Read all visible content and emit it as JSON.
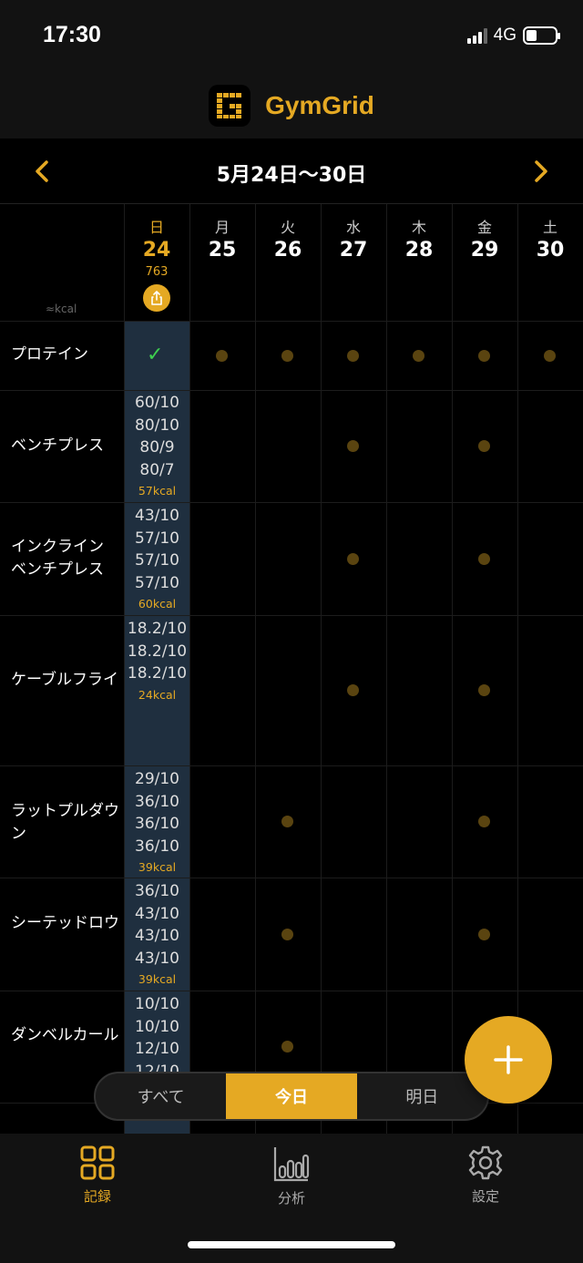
{
  "status": {
    "time": "17:30",
    "network": "4G"
  },
  "app": {
    "title": "GymGrid"
  },
  "week": {
    "range": "5月24日〜30日"
  },
  "kcal_unit": "≈kcal",
  "days": [
    {
      "dow": "日",
      "num": "24",
      "kcal": "763",
      "today": true
    },
    {
      "dow": "月",
      "num": "25"
    },
    {
      "dow": "火",
      "num": "26"
    },
    {
      "dow": "水",
      "num": "27"
    },
    {
      "dow": "木",
      "num": "28"
    },
    {
      "dow": "金",
      "num": "29"
    },
    {
      "dow": "土",
      "num": "30"
    }
  ],
  "exercises": [
    {
      "name": "プロテイン",
      "today_check": "✓"
    },
    {
      "name": "ベンチプレス",
      "sets": [
        "60/10",
        "80/10",
        "80/9",
        "80/7"
      ],
      "kcal": "57kcal"
    },
    {
      "name": "インクライン ベンチプレス",
      "sets": [
        "43/10",
        "57/10",
        "57/10",
        "57/10"
      ],
      "kcal": "60kcal"
    },
    {
      "name": "ケーブルフライ",
      "sets": [
        "18.2/10",
        "18.2/10",
        "18.2/10"
      ],
      "kcal": "24kcal"
    },
    {
      "name": "ラットプルダウン",
      "sets": [
        "29/10",
        "36/10",
        "36/10",
        "36/10"
      ],
      "kcal": "39kcal"
    },
    {
      "name": "シーテッドロウ",
      "sets": [
        "36/10",
        "43/10",
        "43/10",
        "43/10"
      ],
      "kcal": "39kcal"
    },
    {
      "name": "ダンベルカール",
      "sets": [
        "10/10",
        "10/10",
        "12/10",
        "12/10"
      ]
    }
  ],
  "filter": {
    "all": "すべて",
    "today": "今日",
    "tomorrow": "明日",
    "selected": "今日"
  },
  "tabs": [
    {
      "label": "記録",
      "icon": "grid-icon",
      "active": true
    },
    {
      "label": "分析",
      "icon": "bar-chart-icon"
    },
    {
      "label": "設定",
      "icon": "gear-icon"
    }
  ],
  "colors": {
    "accent": "#e5a923",
    "today_column": "#1f2f3f",
    "background": "#000000"
  }
}
